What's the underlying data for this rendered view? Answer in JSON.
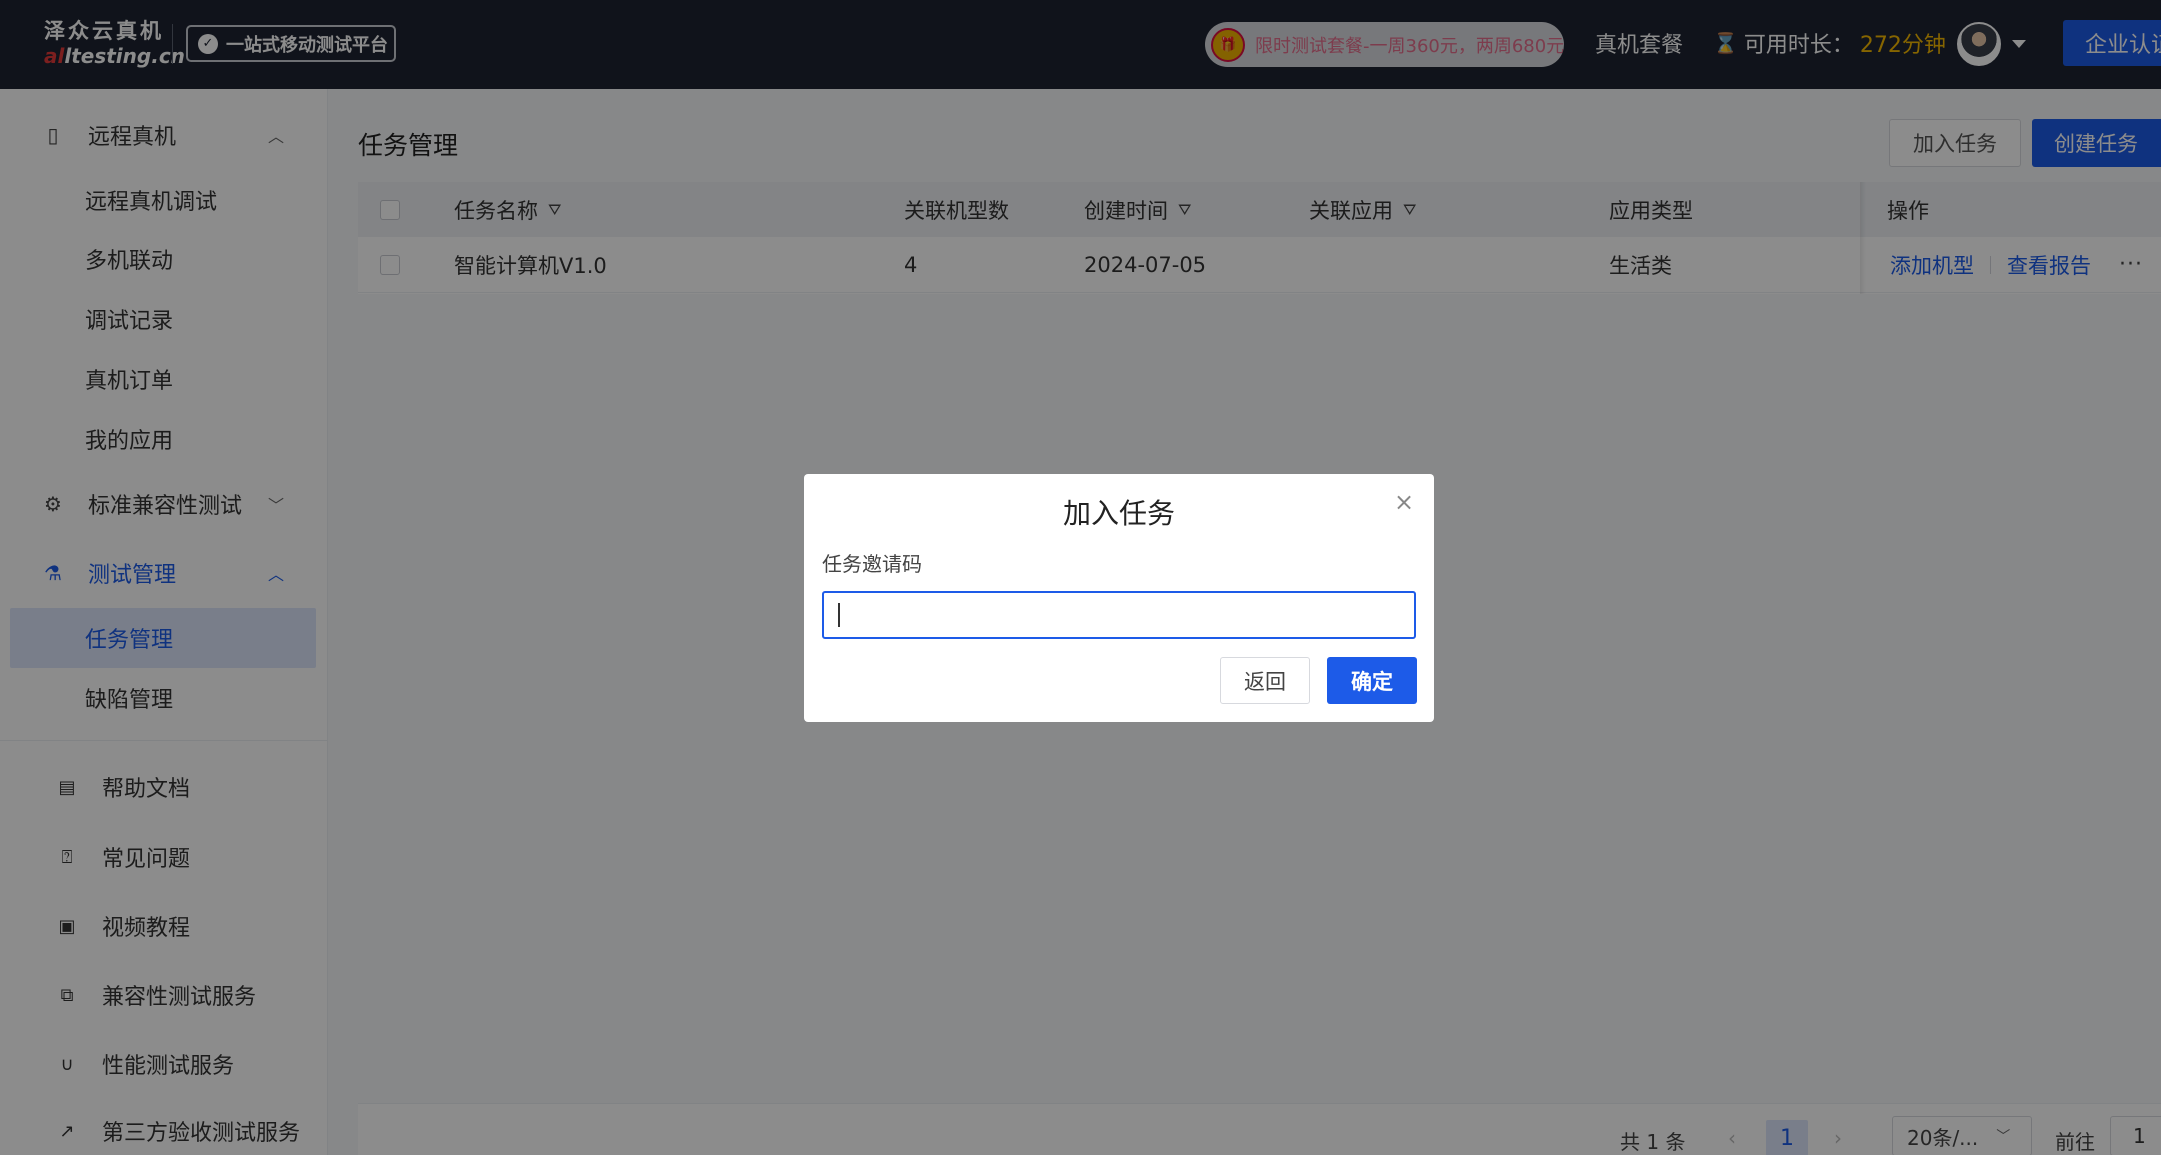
{
  "header": {
    "logo_cn": "泽众云真机",
    "logo_en_accent": "al",
    "logo_en_rest": "ltesting.cn",
    "platform_badge": "一站式移动测试平台",
    "promo": "限时测试套餐-一周360元，两周680元",
    "nav_package": "真机套餐",
    "available_label": "可用时长：",
    "available_value": "272分钟",
    "enterprise_button": "企业认证"
  },
  "sidebar": {
    "groups": [
      {
        "label": "远程真机",
        "icon": "device-icon",
        "expanded": true,
        "items": [
          "远程真机调试",
          "多机联动",
          "调试记录",
          "真机订单",
          "我的应用"
        ]
      },
      {
        "label": "标准兼容性测试",
        "icon": "gear-icon",
        "expanded": false,
        "items": []
      },
      {
        "label": "测试管理",
        "icon": "flask-icon",
        "expanded": true,
        "items": [
          "任务管理",
          "缺陷管理"
        ]
      }
    ],
    "active_item": "任务管理",
    "links": [
      {
        "label": "帮助文档",
        "icon": "book-icon"
      },
      {
        "label": "常见问题",
        "icon": "question-icon"
      },
      {
        "label": "视频教程",
        "icon": "video-icon"
      },
      {
        "label": "兼容性测试服务",
        "icon": "copy-icon"
      },
      {
        "label": "性能测试服务",
        "icon": "magnet-icon"
      },
      {
        "label": "第三方验收测试服务",
        "icon": "chart-icon"
      }
    ]
  },
  "main": {
    "title": "任务管理",
    "join_button": "加入任务",
    "create_button": "创建任务",
    "table": {
      "columns": [
        "任务名称",
        "关联机型数",
        "创建时间",
        "关联应用",
        "应用类型",
        "操作"
      ],
      "rows": [
        {
          "name": "智能计算机V1.0",
          "device_count": "4",
          "created": "2024-07-05",
          "app": "",
          "app_type": "生活类",
          "actions": [
            "添加机型",
            "查看报告"
          ],
          "more": "···"
        }
      ]
    },
    "pagination": {
      "total": "共 1 条",
      "current_page": "1",
      "page_size": "20条/...",
      "goto_label": "前往",
      "goto_value": "1"
    }
  },
  "modal": {
    "title": "加入任务",
    "close": "×",
    "field_label": "任务邀请码",
    "field_value": "",
    "back_button": "返回",
    "ok_button": "确定"
  },
  "colors": {
    "primary": "#1d5be8",
    "header_bg": "#1e2432",
    "accent_time": "#f5b800",
    "promo_text": "#e36e8c"
  }
}
